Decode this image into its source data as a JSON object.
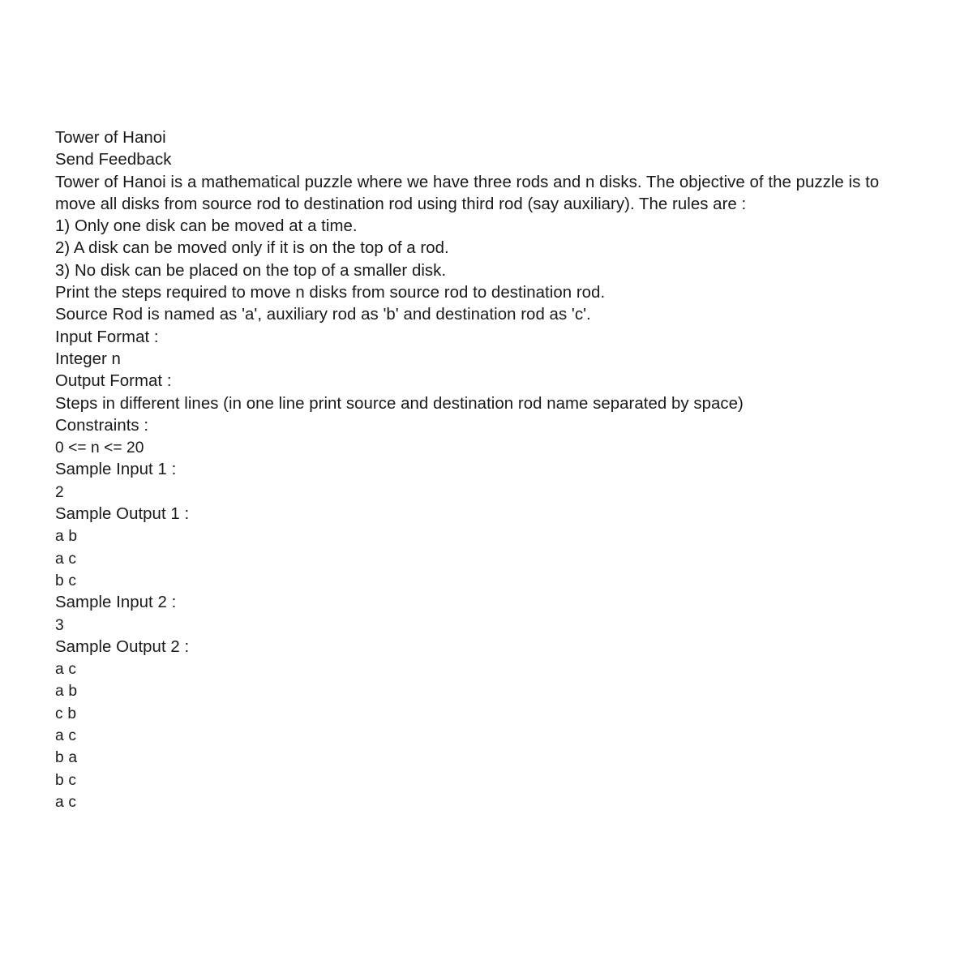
{
  "document": {
    "title": "Tower of Hanoi",
    "feedback_link": "Send Feedback",
    "description": "Tower of Hanoi is a mathematical puzzle where we have three rods and n disks. The objective of the puzzle is to move all disks from source rod to destination rod using third rod (say auxiliary). The rules are :",
    "rules": [
      "1) Only one disk can be moved at a time.",
      "2) A disk can be moved only if it is on the top of a rod.",
      "3) No disk can be placed on the top of a smaller disk."
    ],
    "task_line": "Print the steps required to move n disks from source rod to destination rod.",
    "naming_line": "Source Rod is named as 'a', auxiliary rod as 'b' and destination rod as 'c'.",
    "input_format_label": "Input Format :",
    "input_format_value": "Integer n",
    "output_format_label": "Output Format :",
    "output_format_value": "Steps in different lines (in one line print source and destination rod name separated by space)",
    "constraints_label": "Constraints :",
    "constraints_value": "0 <= n <= 20",
    "samples": [
      {
        "input_label": "Sample Input 1 :",
        "input_value": "2",
        "output_label": "Sample Output 1 :",
        "output_lines": [
          "a b",
          "a c",
          "b c"
        ]
      },
      {
        "input_label": "Sample Input 2 :",
        "input_value": "3",
        "output_label": "Sample Output 2 :",
        "output_lines": [
          "a c",
          "a b",
          "c b",
          "a c",
          "b a",
          "b c",
          "a c"
        ]
      }
    ]
  },
  "colors": {
    "background": "#ffffff",
    "text": "#191919"
  }
}
